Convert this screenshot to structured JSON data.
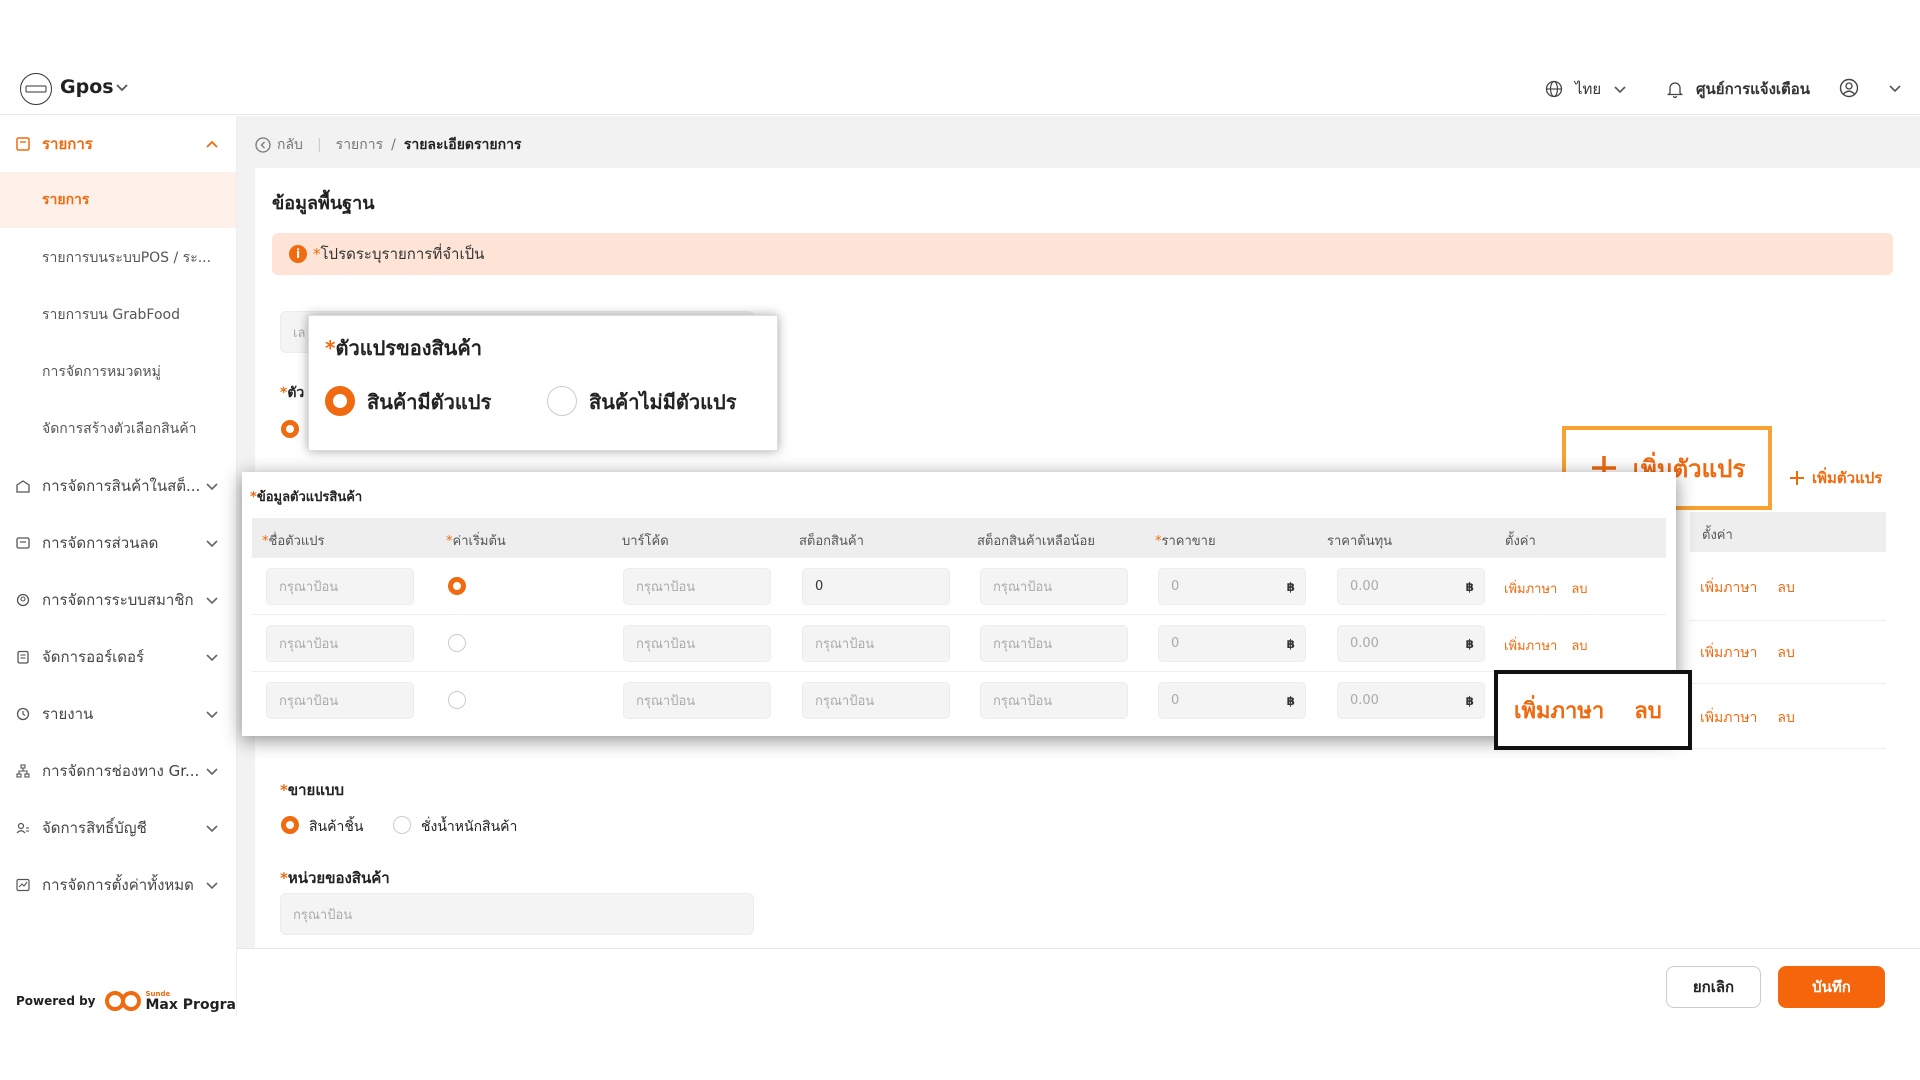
{
  "app": {
    "logo_text": "Gpos",
    "name": "Gpos"
  },
  "topbar": {
    "language": "ไทย",
    "notifications": "ศูนย์การแจ้งเตือน"
  },
  "sidebar": {
    "items": [
      {
        "label": "รายการ"
      },
      {
        "label": "การจัดการสินค้าในสต็..."
      },
      {
        "label": "การจัดการส่วนลด"
      },
      {
        "label": "การจัดการระบบสมาชิก"
      },
      {
        "label": "จัดการออร์เดอร์"
      },
      {
        "label": "รายงาน"
      },
      {
        "label": "การจัดการช่องทาง Gr..."
      },
      {
        "label": "จัดการสิทธิ์บัญชี"
      },
      {
        "label": "การจัดการตั้งค่าทั้งหมด"
      }
    ],
    "sub_items": [
      {
        "label": "รายการ"
      },
      {
        "label": "รายการบนระบบPOS / ระ..."
      },
      {
        "label": "รายการบน GrabFood"
      },
      {
        "label": "การจัดการหมวดหมู่"
      },
      {
        "label": "จัดการสร้างตัวเลือกสินค้า"
      }
    ],
    "powered_by": "Powered by",
    "brand_small": "Sunde",
    "brand": "Max Program"
  },
  "breadcrumb": {
    "back": "กลับ",
    "parent": "รายการ",
    "current": "รายละเอียดรายการ"
  },
  "main": {
    "section_title": "ข้อมูลพื้นฐาน",
    "alert": "โปรดระบุรายการที่จำเป็น",
    "bg_name_placeholder": "เล",
    "bg_variant_label": "ตัว"
  },
  "variant_popup": {
    "title": "ตัวแปรของสินค้า",
    "option_yes": "สินค้ามีตัวแปร",
    "option_no": "สินค้าไม่มีตัวแปร"
  },
  "variant_table": {
    "title": "ข้อมูลตัวแปรสินค้า",
    "headers": [
      "ชื่อตัวแปร",
      "ค่าเริ่มต้น",
      "บาร์โค้ด",
      "สต็อกสินค้า",
      "สต็อกสินค้าเหลือน้อย",
      "ราคาขาย",
      "ราคาต้นทุน",
      "ตั้งค่า"
    ],
    "placeholder": "กรุณาป้อน",
    "rows": [
      {
        "stock": "0",
        "price": "0",
        "cost": "0.00"
      },
      {
        "stock": "กรุณาป้อน",
        "price": "0",
        "cost": "0.00"
      },
      {
        "stock": "กรุณาป้อน",
        "price": "0",
        "cost": "0.00"
      }
    ],
    "currency": "฿",
    "add_language": "เพิ่มภาษา",
    "delete": "ลบ"
  },
  "add_variant": {
    "label": "เพิ่มตัวแปร"
  },
  "bg_table": {
    "settings": "ตั้งค่า",
    "add_language": "เพิ่มภาษา",
    "delete": "ลบ"
  },
  "sell_type": {
    "label": "ขายแบบ",
    "option_piece": "สินค้าชิ้น",
    "option_weight": "ชั่งน้ำหนักสินค้า"
  },
  "unit": {
    "label": "หน่วยของสินค้า",
    "placeholder": "กรุณาป้อน"
  },
  "footer": {
    "cancel": "ยกเลิก",
    "save": "บันทึก"
  },
  "colors": {
    "accent": "#f06a0f",
    "alert_bg": "#fde4d6",
    "highlight": "#f7a233"
  }
}
